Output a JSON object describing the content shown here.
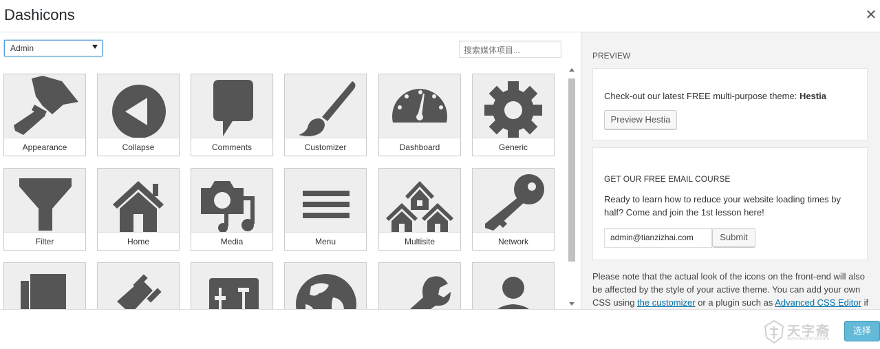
{
  "window": {
    "title": "Dashicons"
  },
  "filter": {
    "selected": "Admin",
    "search_placeholder": "搜索媒体项目..."
  },
  "icons": [
    {
      "label": "Appearance",
      "icon": "paintbrush-icon"
    },
    {
      "label": "Collapse",
      "icon": "collapse-icon"
    },
    {
      "label": "Comments",
      "icon": "comments-icon"
    },
    {
      "label": "Customizer",
      "icon": "customizer-brush-icon"
    },
    {
      "label": "Dashboard",
      "icon": "dashboard-gauge-icon"
    },
    {
      "label": "Generic",
      "icon": "gear-icon"
    },
    {
      "label": "Filter",
      "icon": "funnel-icon"
    },
    {
      "label": "Home",
      "icon": "home-icon"
    },
    {
      "label": "Media",
      "icon": "media-icon"
    },
    {
      "label": "Menu",
      "icon": "menu-icon"
    },
    {
      "label": "Multisite",
      "icon": "multisite-icon"
    },
    {
      "label": "Network",
      "icon": "key-icon"
    },
    {
      "label": "",
      "icon": "page-icon"
    },
    {
      "label": "",
      "icon": "plugin-icon"
    },
    {
      "label": "",
      "icon": "settings-icon"
    },
    {
      "label": "",
      "icon": "globe-icon"
    },
    {
      "label": "",
      "icon": "wrench-icon"
    },
    {
      "label": "",
      "icon": "user-icon"
    }
  ],
  "preview": {
    "heading": "PREVIEW",
    "promo_text": "Check-out our latest FREE multi-purpose theme: ",
    "promo_theme": "Hestia",
    "promo_button": "Preview Hestia",
    "course_heading": "GET OUR FREE EMAIL COURSE",
    "course_text": "Ready to learn how to reduce your website loading times by half? Come and join the 1st lesson here!",
    "email_value": "admin@tianzizhai.com",
    "submit_label": "Submit",
    "note_1": "Please note that the actual look of the icons on the front-end will also be affected by the style of your active theme. You can add your own CSS using ",
    "note_link_1": "the customizer",
    "note_2": " or a plugin such as ",
    "note_link_2": "Advanced CSS Editor",
    "note_3": " if"
  },
  "footer": {
    "watermark_text": "天字斋",
    "watermark_url": "www.tianzizhai.com",
    "choose_label": "选择"
  },
  "colors": {
    "icon": "#555555",
    "accent": "#2ea2cc",
    "link": "#0073aa"
  }
}
